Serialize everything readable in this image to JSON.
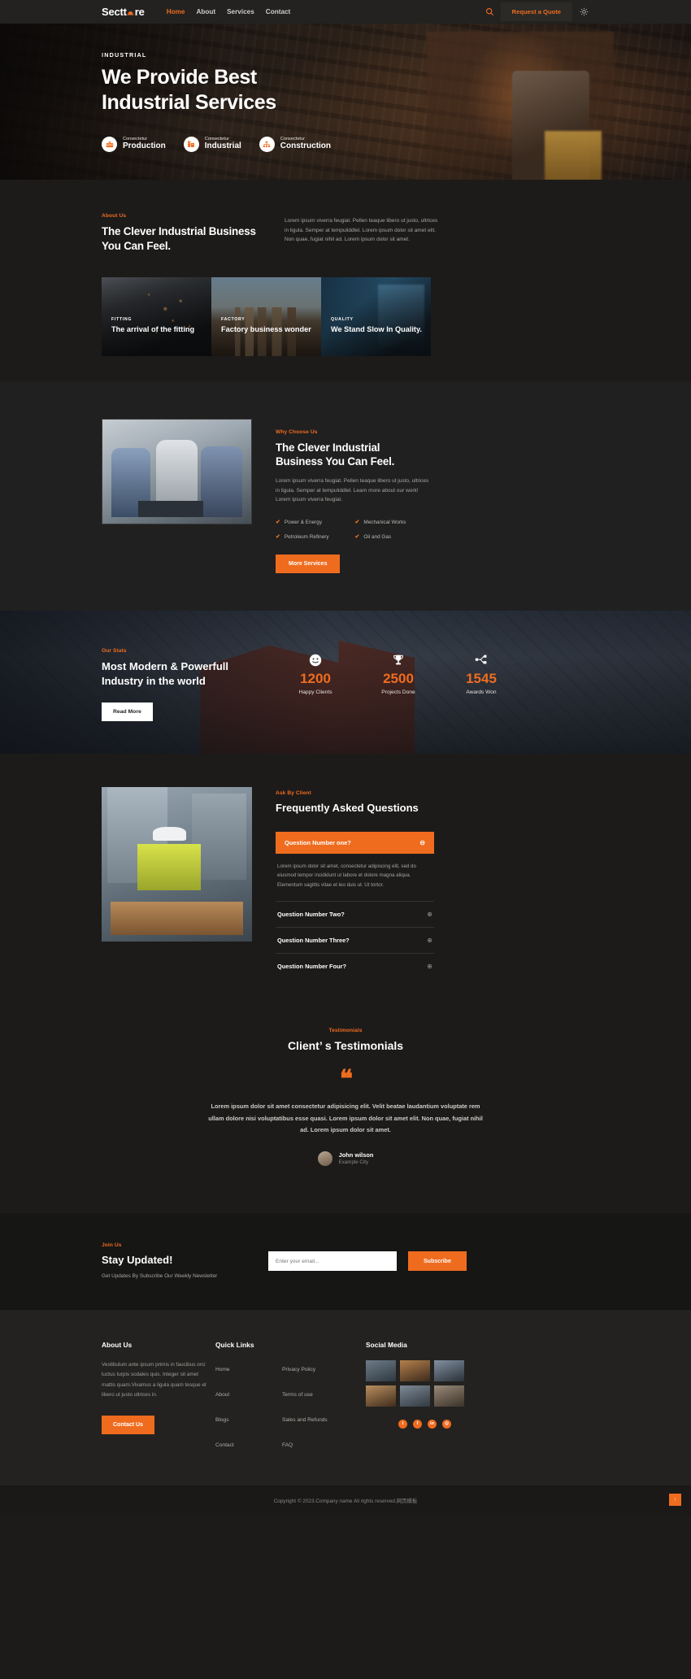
{
  "header": {
    "logo": "Secttore",
    "logo_icon": "hard-hat-icon",
    "nav": [
      {
        "label": "Home",
        "active": true
      },
      {
        "label": "About",
        "active": false
      },
      {
        "label": "Services",
        "active": false
      },
      {
        "label": "Contact",
        "active": false
      }
    ],
    "search_icon": "search-icon",
    "quote_button": "Request a Quote",
    "theme_icon": "sun-icon"
  },
  "hero": {
    "kicker": "INDUSTRIAL",
    "title_line1": "We Provide Best",
    "title_line2": "Industrial Services",
    "badges": [
      {
        "sub": "Consectetur",
        "name": "Production",
        "icon": "toolbox-icon"
      },
      {
        "sub": "Consectetur",
        "name": "Industrial",
        "icon": "factory-icon"
      },
      {
        "sub": "Consectetur",
        "name": "Construction",
        "icon": "sitemap-icon"
      }
    ]
  },
  "about": {
    "kicker": "About Us",
    "heading_line1": "The Clever Industrial Business",
    "heading_line2": "You Can Feel.",
    "paragraph": "Lorem ipsum viverra feugiat. Pellen teaque libero ut justo, ultrices in ligula. Semper at tempuliddlel. Lorem ipsum dolor sit amet elit. Non quae, fugiat nihil ad. Lorem ipsum dolor sit amet.",
    "cards": [
      {
        "kicker": "FITTING",
        "title": "The arrival of the fitting"
      },
      {
        "kicker": "FACTORY",
        "title": "Factory business wonder"
      },
      {
        "kicker": "QUALITY",
        "title": "We Stand Slow In Quality."
      }
    ]
  },
  "why": {
    "kicker": "Why Choose Us",
    "heading_line1": "The Clever Industrial",
    "heading_line2": "Business You Can Feel.",
    "paragraph": "Lorem ipsum viverra feugiat. Pellen teaque libero ut justo, ultrices in ligula. Semper at tempuliddlel. Learn more about our work! Lorem ipsum viverra feugiat.",
    "items": [
      "Power & Energy",
      "Mechanical Works",
      "Petroleum Refinery",
      "Oil and Gas"
    ],
    "button": "More Services"
  },
  "stats": {
    "kicker": "Our Stats",
    "heading": "Most Modern & Powerfull Industry in the world",
    "button": "Read More",
    "items": [
      {
        "icon": "smiley-icon",
        "number": "1200",
        "label": "Happy Clients"
      },
      {
        "icon": "trophy-icon",
        "number": "2500",
        "label": "Projects Done"
      },
      {
        "icon": "share-nodes-icon",
        "number": "1545",
        "label": "Awards Won"
      }
    ]
  },
  "faq": {
    "kicker": "Ask By Client",
    "heading": "Frequently Asked Questions",
    "open_question": "Question Number one?",
    "open_answer": "Lorem ipsum dolor sit amet, consectetur adipiscing elit, sed do eiusmod tempor incididunt ut labore et dolore magna aliqua. Elementum sagittis vitae et leo duis ut. Ut tortor.",
    "collapse_icon": "minus-circle-icon",
    "expand_icon": "plus-circle-icon",
    "questions": [
      "Question Number Two?",
      "Question Number Three?",
      "Question Number Four?"
    ]
  },
  "testimonials": {
    "kicker": "Testimonials",
    "heading": "Client’ s Testimonials",
    "quote_icon": "quote-mark-icon",
    "body": "Lorem ipsum dolor sit amet consectetur adipisicing elit. Velit beatae laudantium voluptate rem ullam dolore nisi voluptatibus esse quasi. Lorem ipsum dolor sit amet elit. Non quae, fugiat nihil ad. Lorem ipsum dolor sit amet.",
    "author_name": "John wilson",
    "author_city": "Example City"
  },
  "newsletter": {
    "kicker": "Join Us",
    "heading": "Stay Updated!",
    "sub": "Get Updates By Subscribe Our Weekly Newsletter",
    "input_placeholder": "Enter your email...",
    "input_value": "",
    "button": "Subscribe"
  },
  "footer": {
    "about_title": "About Us",
    "about_text": "Vestibulum ante ipsum primis in faucibus orci luctus turpis sodales quis. Integer sit amet mattis quam.Vivamus a ligula quam tesque et libero ut justo ultrices in.",
    "contact_button": "Contact Us",
    "quick_title": "Quick Links",
    "quick_col1": [
      "Home",
      "About",
      "Blogs",
      "Contact"
    ],
    "quick_col2": [
      "Privacy Policy",
      "Terms of use",
      "Sales and Refunds",
      "FAQ"
    ],
    "social_title": "Social Media",
    "social_icons": [
      "twitter-icon",
      "facebook-icon",
      "linkedin-icon",
      "instagram-icon"
    ],
    "social_letters": [
      "t",
      "f",
      "in",
      "◎"
    ],
    "copyright": "Copyright © 2023.Company name All rights reserved.网页模板",
    "scroll_top": "↑"
  },
  "colors": {
    "accent": "#ef6c1f",
    "bg": "#1c1b1a",
    "panel": "#202020",
    "footer_bg": "#232220"
  }
}
